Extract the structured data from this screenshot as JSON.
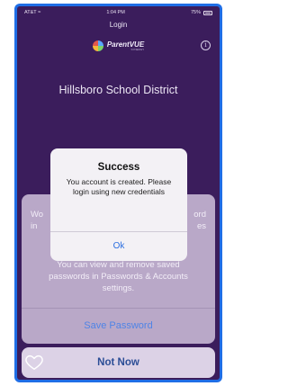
{
  "status_bar": {
    "carrier": "AT&T",
    "time": "1:04 PM",
    "battery": "75%"
  },
  "nav": {
    "title": "Login"
  },
  "brand": {
    "name": "ParentVUE",
    "subtitle": "SYNERGY"
  },
  "district": "Hillsboro School District",
  "save_sheet": {
    "text_top": "Wo                                              ord\nin                                           es",
    "text": "You can view and remove saved passwords in Passwords & Accounts settings.",
    "save_label": "Save Password",
    "not_now_label": "Not Now"
  },
  "alert": {
    "title": "Success",
    "message": "You account is created. Please login using new credentials",
    "ok_label": "Ok"
  },
  "icons": {
    "info": "info-icon",
    "heart": "heart-icon",
    "wifi": "wifi-icon"
  }
}
